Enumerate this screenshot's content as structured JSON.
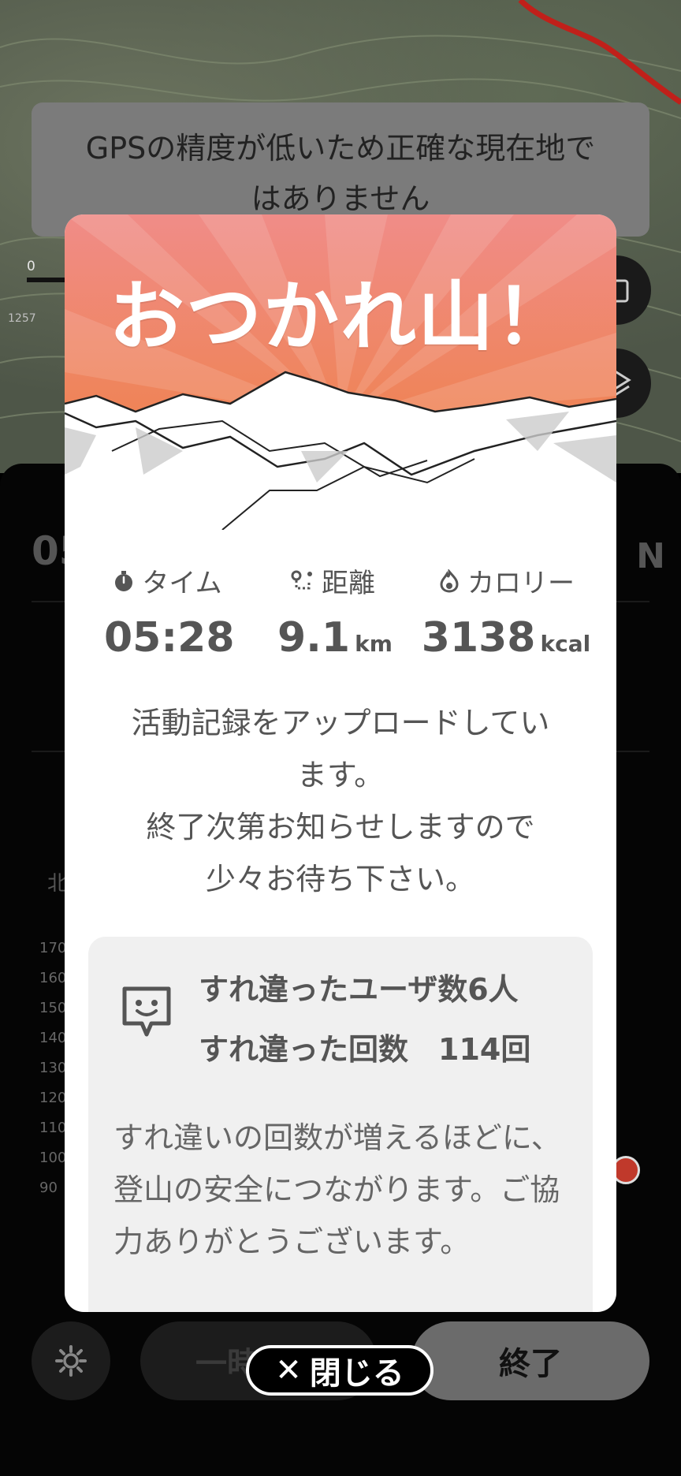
{
  "gps_banner": {
    "text": "GPSの精度が低いため正確な現在地ではありません"
  },
  "map": {
    "scale_label": "0",
    "elevation_label": "1257"
  },
  "panel": {
    "time_partial": "05",
    "compass_partial": "N",
    "north_label": "北",
    "axis_labels": [
      "170",
      "160",
      "150",
      "140",
      "130",
      "120",
      "110",
      "100",
      "90"
    ]
  },
  "modal": {
    "title": "おつかれ山！",
    "stats": {
      "time": {
        "label": "タイム",
        "value": "05:28",
        "icon": "stopwatch-icon"
      },
      "distance": {
        "label": "距離",
        "value": "9.1",
        "unit": "km",
        "icon": "route-icon"
      },
      "calorie": {
        "label": "カロリー",
        "value": "3138",
        "unit": "kcal",
        "icon": "flame-icon"
      }
    },
    "message_lines": [
      "活動記録をアップロードしてい",
      "ます。",
      "終了次第お知らせしますので",
      "少々お待ち下さい。"
    ],
    "encounter": {
      "users_line": "すれ違ったユーザ数6人",
      "count_line": "すれ違った回数　114回",
      "body": "すれ違いの回数が増えるほどに、登山の安全につながります。ご協力ありがとうございます。",
      "icon": "smiley-chat-icon"
    }
  },
  "controls": {
    "pause_label": "一時停止",
    "finish_label": "終了",
    "close_label": "閉じる",
    "settings_icon": "gear-icon"
  },
  "colors": {
    "hero_top": "#f08a86",
    "hero_bottom": "#ee7f3a",
    "modal_text": "#555555",
    "route_red": "#c0201a"
  }
}
